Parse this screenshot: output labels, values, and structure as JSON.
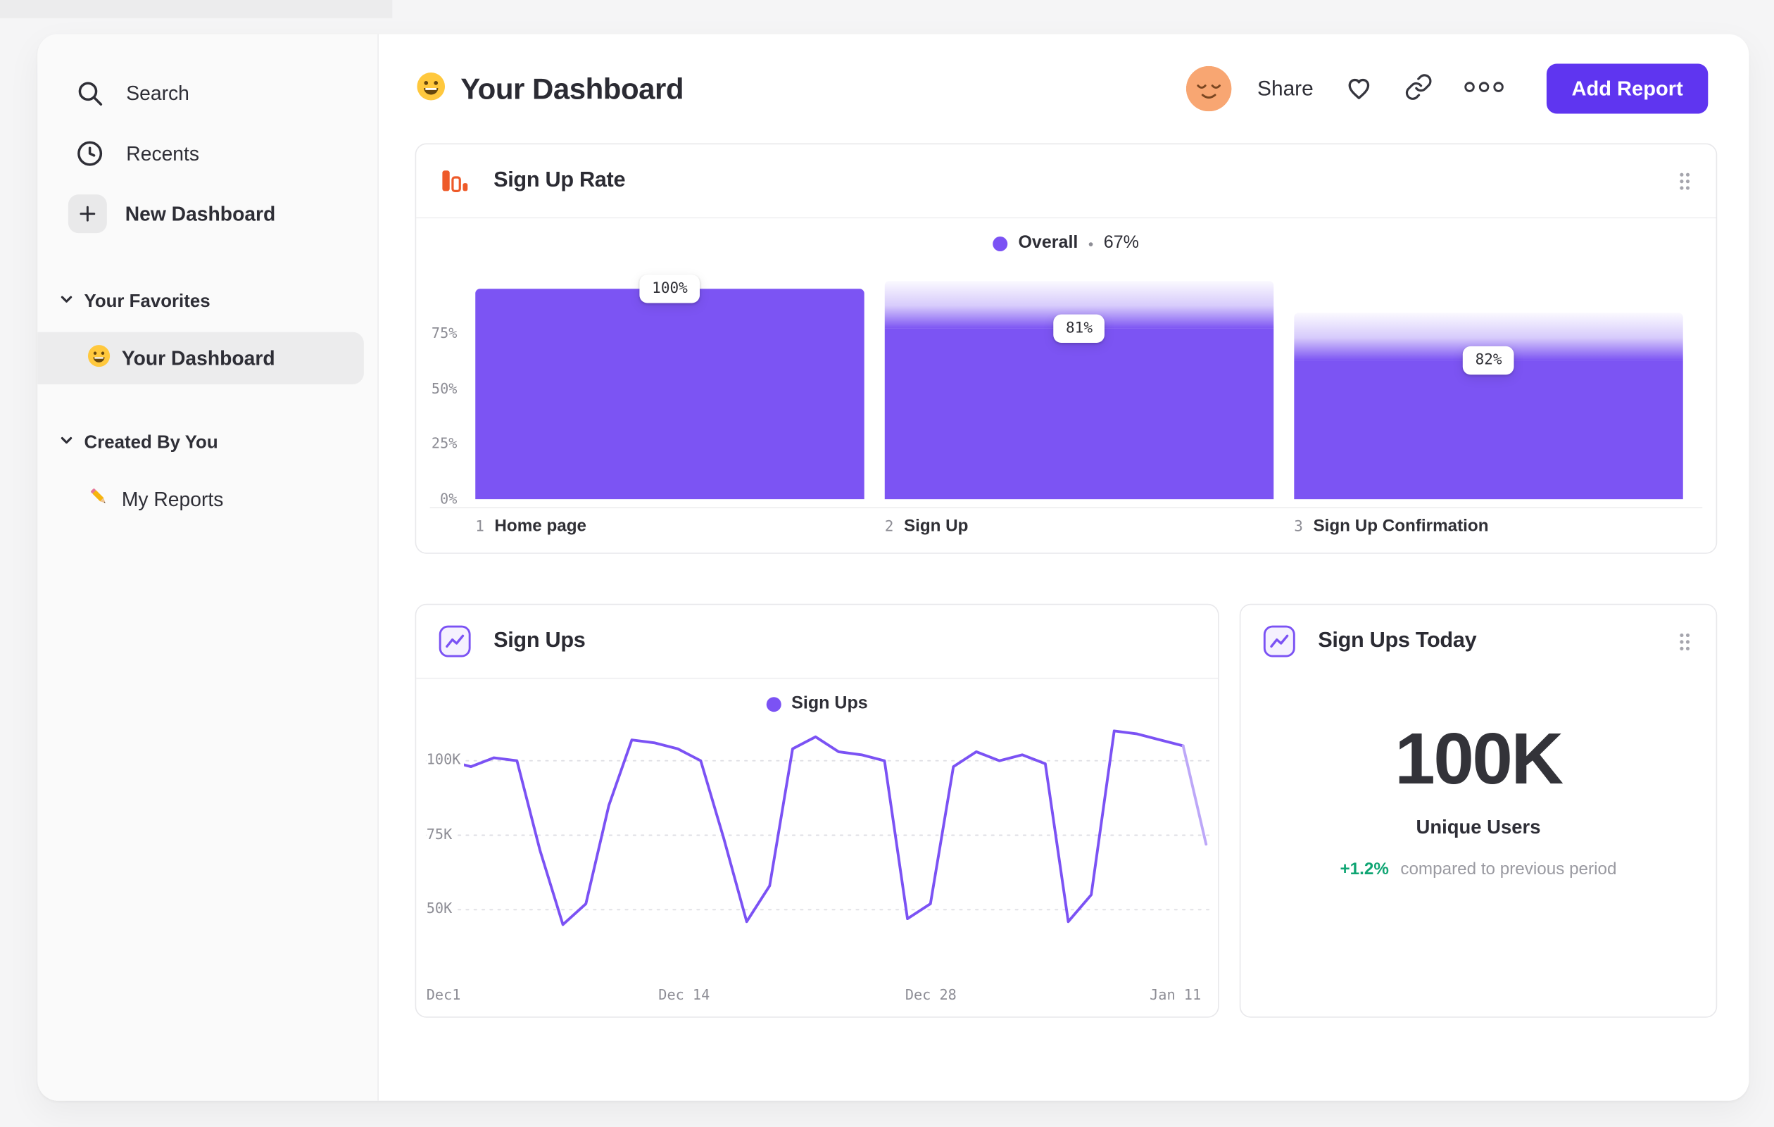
{
  "header": {
    "title": "Your Dashboard",
    "share_label": "Share",
    "add_report_label": "Add Report"
  },
  "sidebar": {
    "items": [
      {
        "label": "Search"
      },
      {
        "label": "Recents"
      },
      {
        "label": "New Dashboard"
      }
    ],
    "sections": [
      {
        "title": "Your Favorites",
        "items": [
          {
            "label": "Your Dashboard"
          }
        ]
      },
      {
        "title": "Created By You",
        "items": [
          {
            "label": "My Reports"
          }
        ]
      }
    ]
  },
  "colors": {
    "accent_purple": "#7B52F4",
    "button_purple": "#5F35F0",
    "funnel_icon_orange": "#EE5A29",
    "positive_green": "#0FA573"
  },
  "chart_data": [
    {
      "type": "bar",
      "variant": "funnel",
      "title": "Sign Up Rate",
      "legend": {
        "label": "Overall",
        "separator": "•",
        "value": "67%"
      },
      "ylabels": [
        {
          "label": "75%",
          "pct": 75
        },
        {
          "label": "50%",
          "pct": 50
        },
        {
          "label": "25%",
          "pct": 25
        },
        {
          "label": "0%",
          "pct": 0
        }
      ],
      "steps": [
        {
          "num": "1",
          "label": "Home page",
          "conversion": "100%",
          "height_pct": 100
        },
        {
          "num": "2",
          "label": "Sign Up",
          "conversion": "81%",
          "height_pct": 81
        },
        {
          "num": "3",
          "label": "Sign Up Confirmation",
          "conversion": "82%",
          "height_pct": 66
        }
      ]
    },
    {
      "type": "line",
      "title": "Sign Ups",
      "legend": {
        "label": "Sign Ups"
      },
      "unit": "K",
      "yticks": [
        {
          "label": "100K",
          "value": 100
        },
        {
          "label": "75K",
          "value": 75
        },
        {
          "label": "50K",
          "value": 50
        }
      ],
      "xticks": [
        "Dec1",
        "Dec 14",
        "Dec 28",
        "Jan 11"
      ],
      "values": [
        100,
        98,
        101,
        100,
        70,
        45,
        52,
        85,
        107,
        106,
        104,
        100,
        74,
        46,
        58,
        104,
        108,
        103,
        102,
        100,
        47,
        52,
        98,
        103,
        100,
        102,
        99,
        46,
        55,
        110,
        109,
        107,
        105,
        72
      ]
    },
    {
      "type": "number",
      "title": "Sign Ups Today",
      "value": "100K",
      "label": "Unique Users",
      "delta": "+1.2%",
      "delta_text": "compared to previous period"
    }
  ]
}
